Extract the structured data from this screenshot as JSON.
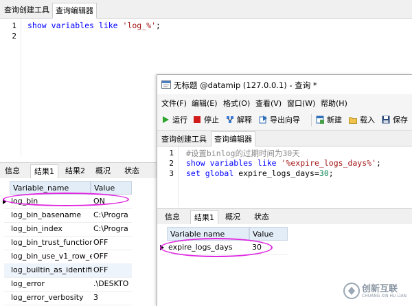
{
  "background_window": {
    "tabs": [
      "查询创建工具",
      "查询编辑器"
    ],
    "active_tab": 1,
    "editor": {
      "line_numbers": [
        "1",
        "2"
      ],
      "code_line1": {
        "kw1": "show",
        "kw2": "variables",
        "kw3": "like",
        "str": "'log_%'",
        "end": ";"
      }
    },
    "result_tabs": [
      "信息",
      "结果1",
      "结果2",
      "概况",
      "状态"
    ],
    "grid": {
      "headers": [
        "Variable_name",
        "Value"
      ],
      "rows": [
        [
          "log_bin",
          "ON"
        ],
        [
          "log_bin_basename",
          "C:\\Progra"
        ],
        [
          "log_bin_index",
          "C:\\Progra"
        ],
        [
          "log_bin_trust_function",
          "OFF"
        ],
        [
          "log_bin_use_v1_row_e",
          "OFF"
        ],
        [
          "log_builtin_as_identifie",
          "OFF"
        ],
        [
          "log_error",
          ".\\DESKTO"
        ],
        [
          "log_error_verbosity",
          "3"
        ]
      ]
    }
  },
  "foreground_window": {
    "title": "无标题 @datamip (127.0.0.1) - 查询 *",
    "menu": [
      "文件(F)",
      "编辑(E)",
      "格式(O)",
      "查看(V)",
      "窗口(W)",
      "帮助(H)"
    ],
    "toolbar": {
      "run": "运行",
      "stop": "停止",
      "explain": "解释",
      "export": "导出向导",
      "new": "新建",
      "load": "载入",
      "save": "保存"
    },
    "tabs": [
      "查询创建工具",
      "查询编辑器"
    ],
    "active_tab": 1,
    "editor": {
      "line_numbers": [
        "1",
        "2",
        "3"
      ],
      "line1_comment": "#设置binlog的过期时间为30天",
      "line2": {
        "kw1": "show",
        "kw2": "variables",
        "kw3": "like",
        "str": "'%expire_logs_days%'",
        "end": ";"
      },
      "line3": {
        "kw1": "set",
        "kw2": "global",
        "ident": "expire_logs_days=",
        "num": "30",
        "end": ";"
      }
    },
    "result_tabs": [
      "信息",
      "结果1",
      "概况",
      "状态"
    ],
    "grid": {
      "headers": [
        "Variable name",
        "Value"
      ],
      "rows": [
        [
          "expire_logs_days",
          "30"
        ]
      ]
    }
  },
  "watermark": {
    "cn": "创新互联",
    "en": "CHUANG XIN HU LIAN"
  },
  "colors": {
    "keyword": "#0000ff",
    "string": "#a31515",
    "number": "#098658",
    "comment": "#8a8a8a",
    "highlight_ellipse": "#e026e0",
    "grid_header": "#e3edf8"
  }
}
